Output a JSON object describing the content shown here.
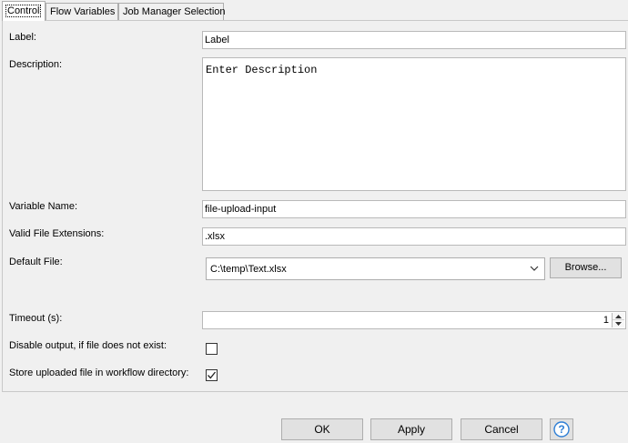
{
  "tabs": [
    {
      "label": "Control",
      "active": true
    },
    {
      "label": "Flow Variables",
      "active": false
    },
    {
      "label": "Job Manager Selection",
      "active": false
    }
  ],
  "form": {
    "label": {
      "label": "Label:",
      "value": "Label"
    },
    "description": {
      "label": "Description:",
      "value": "Enter Description"
    },
    "variable_name": {
      "label": "Variable Name:",
      "value": "file-upload-input"
    },
    "valid_extensions": {
      "label": "Valid File Extensions:",
      "value": ".xlsx"
    },
    "default_file": {
      "label": "Default File:",
      "value": "C:\\temp\\Text.xlsx",
      "browse_label": "Browse..."
    },
    "timeout": {
      "label": "Timeout (s):",
      "value": "1"
    },
    "disable_output": {
      "label": "Disable output, if file does not exist:",
      "checked": false
    },
    "store_uploaded": {
      "label": "Store uploaded file in workflow directory:",
      "checked": true
    }
  },
  "buttons": {
    "ok": "OK",
    "apply": "Apply",
    "cancel": "Cancel",
    "help_icon": "help-icon"
  },
  "colors": {
    "help_accent": "#2f7fd6",
    "background": "#f0f0f0"
  }
}
